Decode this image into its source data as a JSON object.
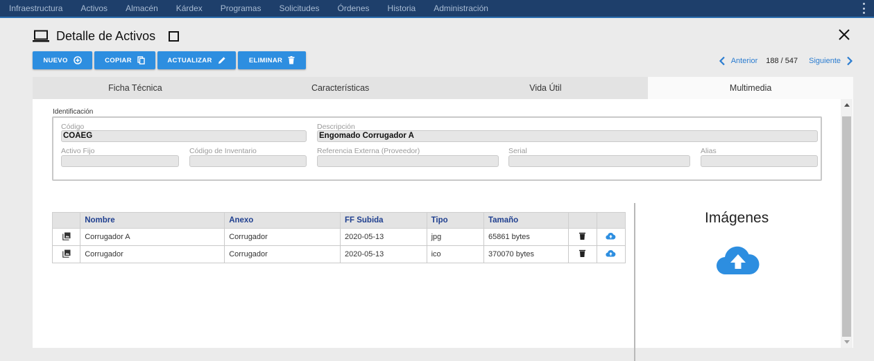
{
  "nav": {
    "items": [
      "Infraestructura",
      "Activos",
      "Almacén",
      "Kárdex",
      "Programas",
      "Solicitudes",
      "Órdenes",
      "Historia",
      "Administración"
    ]
  },
  "header": {
    "title": "Detalle de Activos"
  },
  "toolbar": {
    "nuevo": "NUEVO",
    "copiar": "COPIAR",
    "actualizar": "ACTUALIZAR",
    "eliminar": "ELIMINAR"
  },
  "pager": {
    "prev": "Anterior",
    "count": "188 / 547",
    "next": "Siguiente"
  },
  "tabs": [
    {
      "label": "Ficha Técnica",
      "active": false
    },
    {
      "label": "Características",
      "active": false
    },
    {
      "label": "Vida Útil",
      "active": false
    },
    {
      "label": "Multimedia",
      "active": true
    }
  ],
  "identificacion": {
    "legend": "Identificación",
    "codigo_label": "Código",
    "codigo": "COAEG",
    "descripcion_label": "Descripción",
    "descripcion": "Engomado Corrugador A",
    "activo_fijo_label": "Activo Fijo",
    "activo_fijo": "",
    "codigo_inventario_label": "Código de Inventario",
    "codigo_inventario": "",
    "referencia_label": "Referencia Externa (Proveedor)",
    "referencia": "",
    "serial_label": "Serial",
    "serial": "",
    "alias_label": "Alias",
    "alias": ""
  },
  "files": {
    "columns": [
      "Nombre",
      "Anexo",
      "FF Subida",
      "Tipo",
      "Tamaño"
    ],
    "rows": [
      {
        "nombre": "Corrugador A",
        "anexo": "Corrugador",
        "fecha": "2020-05-13",
        "tipo": "jpg",
        "tamano": "65861 bytes"
      },
      {
        "nombre": "Corrugador",
        "anexo": "Corrugador",
        "fecha": "2020-05-13",
        "tipo": "ico",
        "tamano": "370070 bytes"
      }
    ]
  },
  "imagenes": {
    "title": "Imágenes"
  },
  "colors": {
    "nav_bg": "#1e3f6b",
    "button_blue": "#2d8ee0",
    "link_blue": "#2a7cd0",
    "header_text": "#1f3f8f"
  },
  "icons": [
    "laptop-icon",
    "close-icon",
    "plus-circle-icon",
    "copy-icon",
    "pencil-icon",
    "trash-icon",
    "chevron-left-icon",
    "chevron-right-icon",
    "image-library-icon",
    "cloud-upload-icon"
  ]
}
